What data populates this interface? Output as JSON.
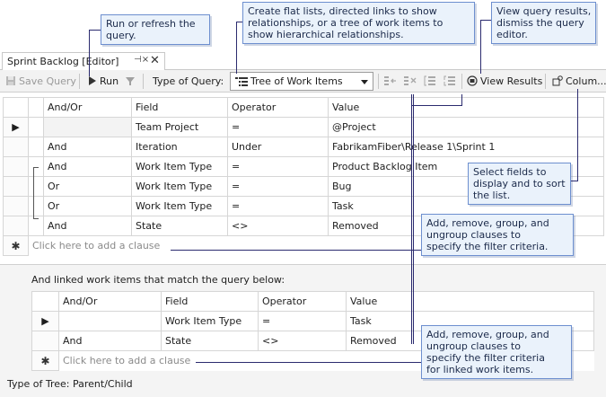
{
  "callouts": {
    "run": [
      "Run or refresh the",
      "query."
    ],
    "type": [
      "Create flat lists, directed links to show",
      "relationships, or a tree of work items to",
      "show hierarchical relationships."
    ],
    "results": [
      "View query results,",
      "dismiss the query",
      "editor."
    ],
    "fields": [
      "Select fields to",
      "display and to sort",
      "the list."
    ],
    "clauses": [
      "Add, remove, group, and",
      "ungroup clauses to",
      "specify the filter criteria."
    ],
    "linked_clauses": [
      "Add, remove, group, and",
      "ungroup clauses to",
      "specify the filter criteria",
      "for linked work items."
    ]
  },
  "tab": {
    "title": "Sprint Backlog [Editor]",
    "pin": "⊣×",
    "close": "✕"
  },
  "toolbar": {
    "save_label": "Save Query",
    "run_label": "Run",
    "type_label": "Type of Query:",
    "query_type": "Tree of Work Items",
    "view_results_label": "View Results",
    "columns_label": "Colum..."
  },
  "query_grid": {
    "headers": [
      "And/Or",
      "Field",
      "Operator",
      "Value"
    ],
    "rows": [
      {
        "andor": "",
        "field": "Team Project",
        "operator": "=",
        "value": "@Project",
        "marker": "▶"
      },
      {
        "andor": "And",
        "field": "Iteration",
        "operator": "Under",
        "value": "FabrikamFiber\\Release 1\\Sprint 1",
        "marker": ""
      },
      {
        "andor": "And",
        "field": "Work Item Type",
        "operator": "=",
        "value": "Product Backlog Item",
        "marker": ""
      },
      {
        "andor": "Or",
        "field": "Work Item Type",
        "operator": "=",
        "value": "Bug",
        "marker": ""
      },
      {
        "andor": "Or",
        "field": "Work Item Type",
        "operator": "=",
        "value": "Task",
        "marker": ""
      },
      {
        "andor": "And",
        "field": "State",
        "operator": "<>",
        "value": "Removed",
        "marker": ""
      }
    ],
    "add_clause": "Click here to add a clause",
    "add_marker": "✱"
  },
  "linked_section": {
    "label": "And linked work items that match the query below:",
    "headers": [
      "And/Or",
      "Field",
      "Operator",
      "Value"
    ],
    "rows": [
      {
        "andor": "",
        "field": "Work Item Type",
        "operator": "=",
        "value": "Task",
        "marker": "▶"
      },
      {
        "andor": "And",
        "field": "State",
        "operator": "<>",
        "value": "Removed",
        "marker": ""
      }
    ],
    "add_clause": "Click here to add a clause",
    "add_marker": "✱"
  },
  "tree_type": "Type of Tree:  Parent/Child"
}
